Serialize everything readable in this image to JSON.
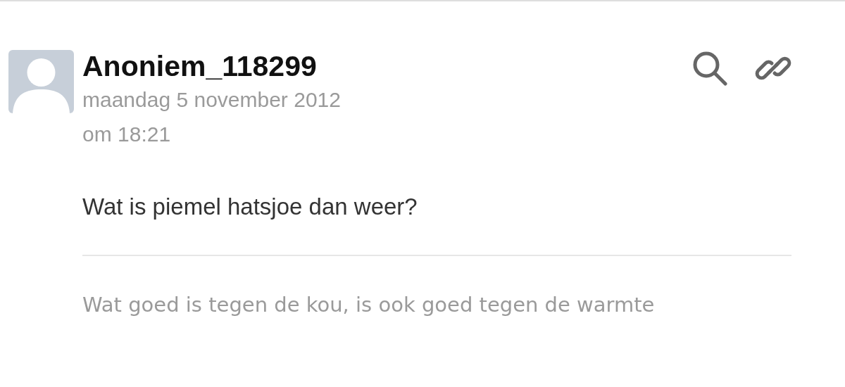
{
  "post": {
    "author": "Anoniem_118299",
    "date": "maandag 5 november 2012",
    "time": "om 18:21",
    "message": "Wat is piemel hatsjoe dan weer?",
    "signature": "Wat goed is tegen de kou, is ook goed tegen de warmte"
  }
}
